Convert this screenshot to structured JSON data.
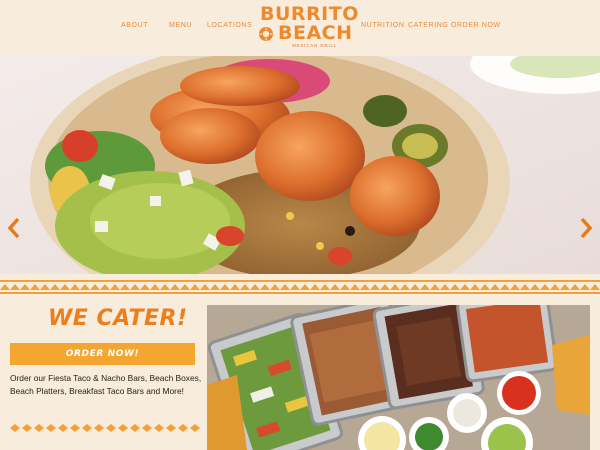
{
  "header": {
    "nav_left": [
      "ABOUT",
      "MENU",
      "LOCATIONS"
    ],
    "nav_right": [
      "NUTRITION",
      "CATERING",
      "ORDER NOW"
    ],
    "logo": {
      "line1": "BURRITO",
      "line2": "BEACH",
      "tagline": "MEXICAN GRILL"
    }
  },
  "hero": {
    "prev_icon": "chevron-left-icon",
    "next_icon": "chevron-right-icon"
  },
  "catering": {
    "title": "WE CATER!",
    "button_label": "ORDER NOW!",
    "description": "Order our Fiesta Taco & Nacho Bars, Beach Boxes, Beach Platters, Breakfast Taco Bars and More!"
  },
  "colors": {
    "background": "#f8ecdc",
    "brand_orange": "#ee8a2e",
    "button": "#f5a630",
    "text": "#2c2018"
  }
}
